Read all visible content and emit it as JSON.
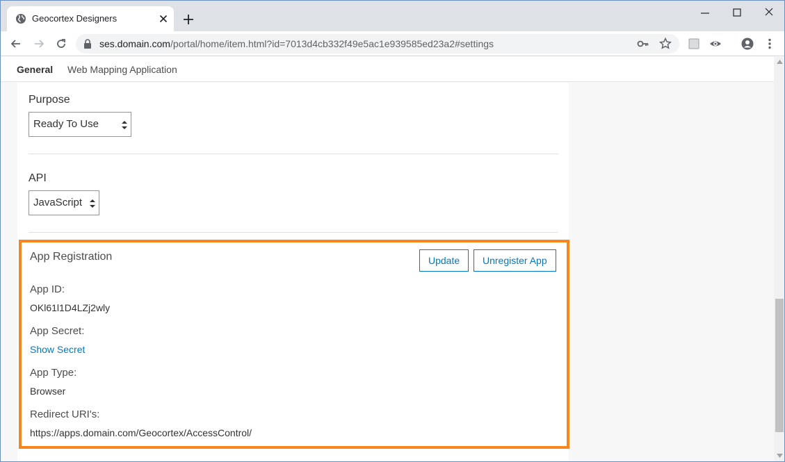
{
  "browser": {
    "tab_title": "Geocortex Designers",
    "url_host": "ses.domain.com",
    "url_path": "/portal/home/item.html?id=7013d4cb332f49e5ac1e939585ed23a2#settings"
  },
  "subnav": {
    "items": [
      {
        "label": "General"
      },
      {
        "label": "Web Mapping Application"
      }
    ]
  },
  "settings": {
    "purpose": {
      "label": "Purpose",
      "value": "Ready To Use"
    },
    "api": {
      "label": "API",
      "value": "JavaScript"
    }
  },
  "registration": {
    "title": "App Registration",
    "update_label": "Update",
    "unregister_label": "Unregister App",
    "app_id_label": "App ID:",
    "app_id_value": "OKl61l1D4LZj2wly",
    "app_secret_label": "App Secret:",
    "show_secret_label": "Show Secret",
    "app_type_label": "App Type:",
    "app_type_value": "Browser",
    "redirect_label": "Redirect URI's:",
    "redirect_value": "https://apps.domain.com/Geocortex/AccessControl/"
  },
  "colors": {
    "accent": "#0079c1",
    "highlight_border": "#f7861f"
  },
  "icons": [
    "globe-icon",
    "close-icon",
    "plus-icon",
    "minimize-icon",
    "maximize-icon",
    "back-icon",
    "forward-icon",
    "reload-icon",
    "lock-icon",
    "key-icon",
    "star-icon",
    "extension-icon",
    "eye-icon",
    "account-icon",
    "more-icon"
  ]
}
